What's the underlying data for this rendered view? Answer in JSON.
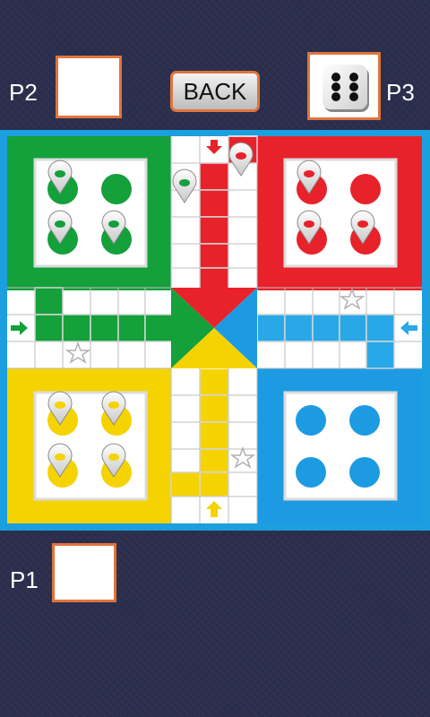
{
  "players": {
    "p1_label": "P1",
    "p2_label": "P2",
    "p3_label": "P3"
  },
  "buttons": {
    "back_label": "BACK"
  },
  "dice": {
    "value": 6
  },
  "board": {
    "colors": {
      "green": "#14a03b",
      "red": "#e8222a",
      "yellow": "#f5d300",
      "blue": "#1d9be2",
      "frame": "#1c9fde"
    },
    "tokens": {
      "green_in_yard": 3,
      "green_on_track": 1,
      "red_in_yard": 3,
      "red_on_track": 1,
      "yellow_in_yard": 4,
      "blue_in_yard": 0
    }
  }
}
